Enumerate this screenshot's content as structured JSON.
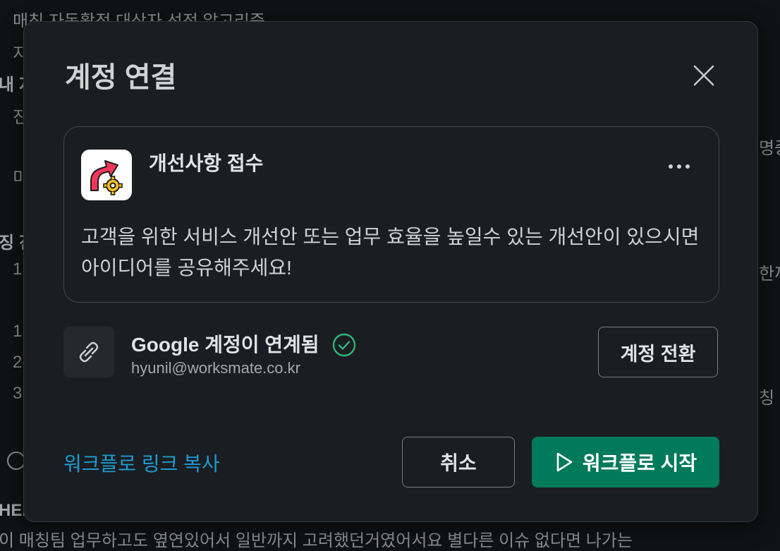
{
  "background": {
    "lines": [
      "매칭 자동활적 대상자 선정 알고리즘",
      "지",
      "내 지",
      "진",
      "명중",
      "미",
      "징 진",
      "1",
      "한까",
      "1",
      "2",
      "3",
      "칭",
      "HER",
      "이 매칭팀 업무하고도 옆연있어서 일반까지 고려했던거였어서요 별다른 이슈 없다면 나가는"
    ]
  },
  "modal": {
    "title": "계정 연결",
    "close_icon": "close-icon",
    "card": {
      "app_icon": "improvement-arrow-gear-icon",
      "title": "개선사항 접수",
      "more_icon": "more-horizontal-icon",
      "description": "고객을 위한 서비스 개선안 또는 업무 효율을 높일수 있는 개선안이 있으시면 아이디어를 공유해주세요!"
    },
    "account": {
      "link_icon": "link-icon",
      "title": "Google 계정이 연계됨",
      "check_icon": "check-circle-icon",
      "email": "hyunil@worksmate.co.kr",
      "switch_label": "계정 전환"
    },
    "footer": {
      "copy_link_label": "워크플로 링크 복사",
      "cancel_label": "취소",
      "start_label": "워크플로 시작",
      "start_icon": "play-icon"
    }
  },
  "colors": {
    "accent_green": "#007a5a",
    "link_blue": "#1d9bd1",
    "check_green": "#2eb67d",
    "modal_bg": "#1a1d21"
  }
}
